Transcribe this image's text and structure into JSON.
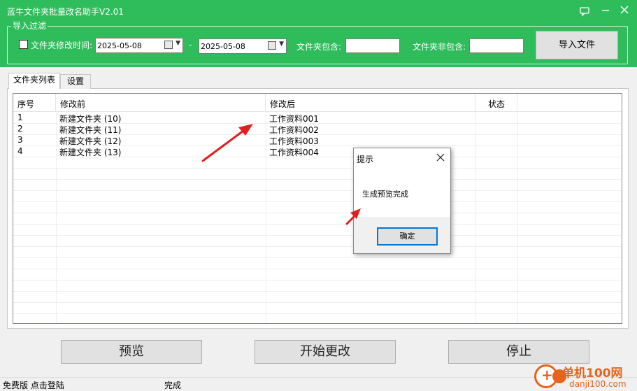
{
  "window": {
    "title": "蓝牛文件夹批量改名助手V2.01",
    "icons": [
      "feedback-icon",
      "minimize-icon",
      "close-icon"
    ]
  },
  "filter": {
    "group_title": "导入过滤",
    "modify_time_label": "文件夹修改时间:",
    "modify_time_checked": false,
    "date_from": "2025-05-08",
    "date_separator": "-",
    "date_to": "2025-05-08",
    "include_label": "文件夹包含:",
    "include_value": "",
    "exclude_label": "文件夹非包含:",
    "exclude_value": "",
    "import_button": "导入文件"
  },
  "tabs": [
    {
      "label": "文件夹列表",
      "active": true
    },
    {
      "label": "设置",
      "active": false
    }
  ],
  "table": {
    "columns": [
      "序号",
      "修改前",
      "修改后",
      "状态"
    ],
    "rows": [
      {
        "index": "1",
        "before": "新建文件夹 (10)",
        "after": "工作资料001",
        "status": ""
      },
      {
        "index": "2",
        "before": "新建文件夹 (11)",
        "after": "工作资料002",
        "status": ""
      },
      {
        "index": "3",
        "before": "新建文件夹 (12)",
        "after": "工作资料003",
        "status": ""
      },
      {
        "index": "4",
        "before": "新建文件夹 (13)",
        "after": "工作资料004",
        "status": ""
      }
    ]
  },
  "dialog": {
    "title": "提示",
    "message": "生成预览完成",
    "ok_button": "确定"
  },
  "actions": {
    "preview": "预览",
    "start": "开始更改",
    "stop": "停止"
  },
  "status": {
    "login": "免费版 点击登陆",
    "state": "完成"
  },
  "watermark": {
    "title": "单机100网",
    "url": "danji100.com"
  },
  "colors": {
    "title_green": "#2fbd5c",
    "arrow_red": "#e02020",
    "watermark_orange": "#e6641b"
  }
}
